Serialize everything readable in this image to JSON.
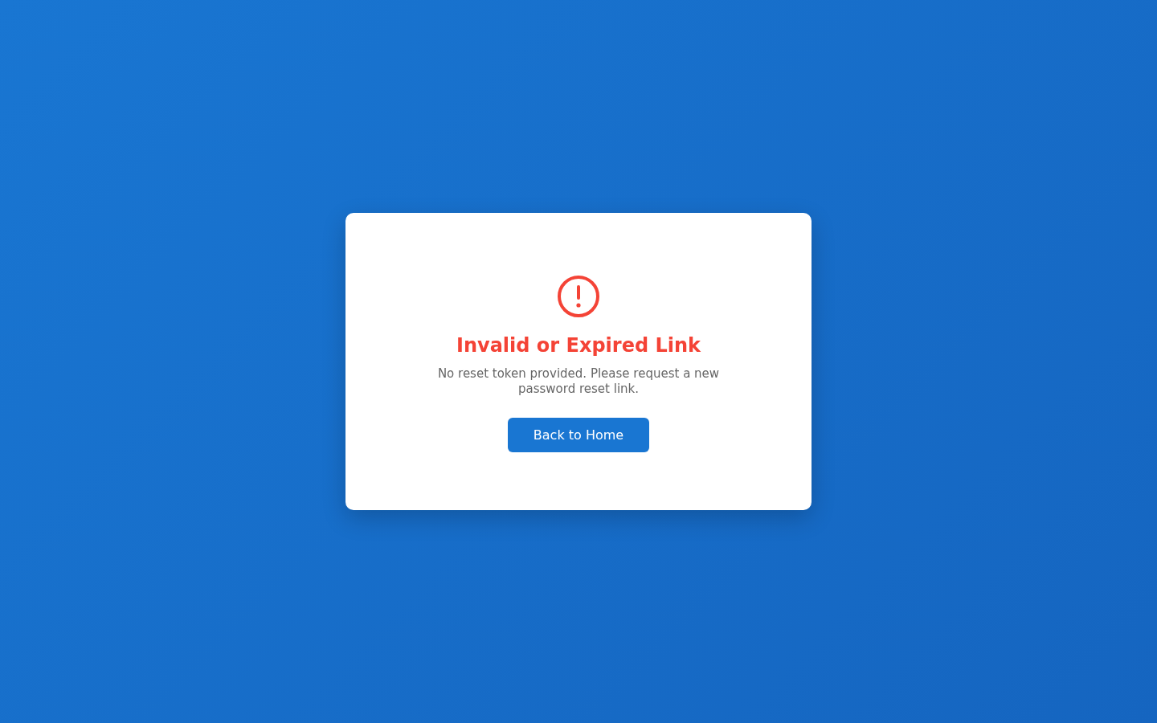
{
  "card": {
    "kind": "error",
    "title": "Invalid or Expired Link",
    "message": "No reset token provided. Please request a new password reset link.",
    "button": "Back to Home"
  }
}
